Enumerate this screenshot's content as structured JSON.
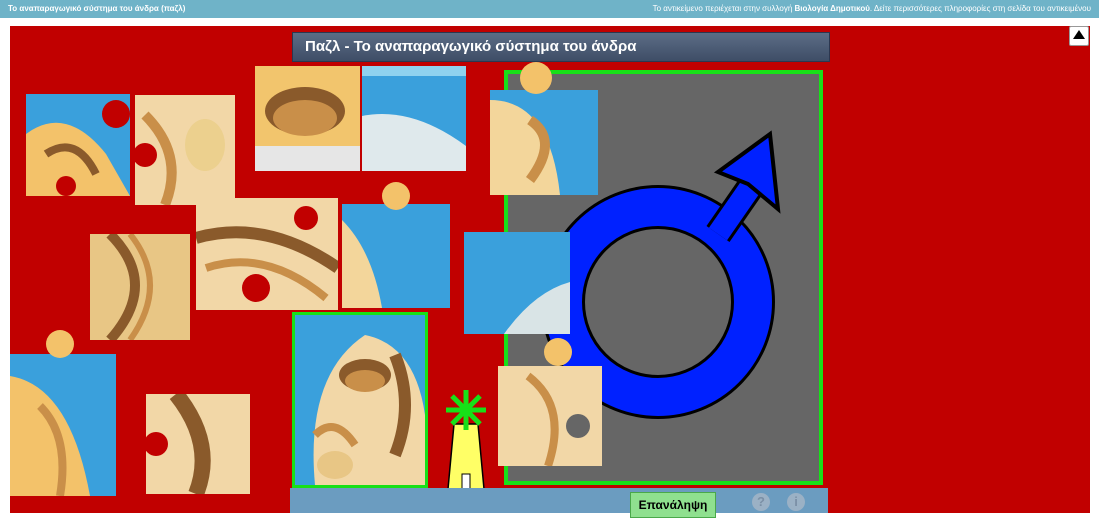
{
  "topbar": {
    "left_title": "Το αναπαραγωγικό σύστημα του άνδρα (παζλ)",
    "right_text_prefix": "Το αντικείμενο περιέχεται στην συλλογή ",
    "right_collection": "Βιολογία Δημοτικού",
    "right_text_suffix": ". Δείτε περισσότερες πληροφορίες στη σελίδα του αντικειμένου ",
    "colors": {
      "bar": "#6fb3c8"
    }
  },
  "game": {
    "title": "Παζλ - Το αναπαραγωγικό σύστημα του άνδρα",
    "repeat_label": "Επανάληψη",
    "help_label": "?",
    "info_label": "i",
    "colors": {
      "stage": "#c10000",
      "board": "#666666",
      "board_border": "#18e018",
      "symbol": "#0021ff",
      "button": "#8fe08f"
    },
    "icons": {
      "scroll_top": "triangle-up-icon",
      "help": "question-icon",
      "info": "info-icon",
      "loader": "windmill-icon",
      "symbol": "male-symbol-icon"
    }
  }
}
